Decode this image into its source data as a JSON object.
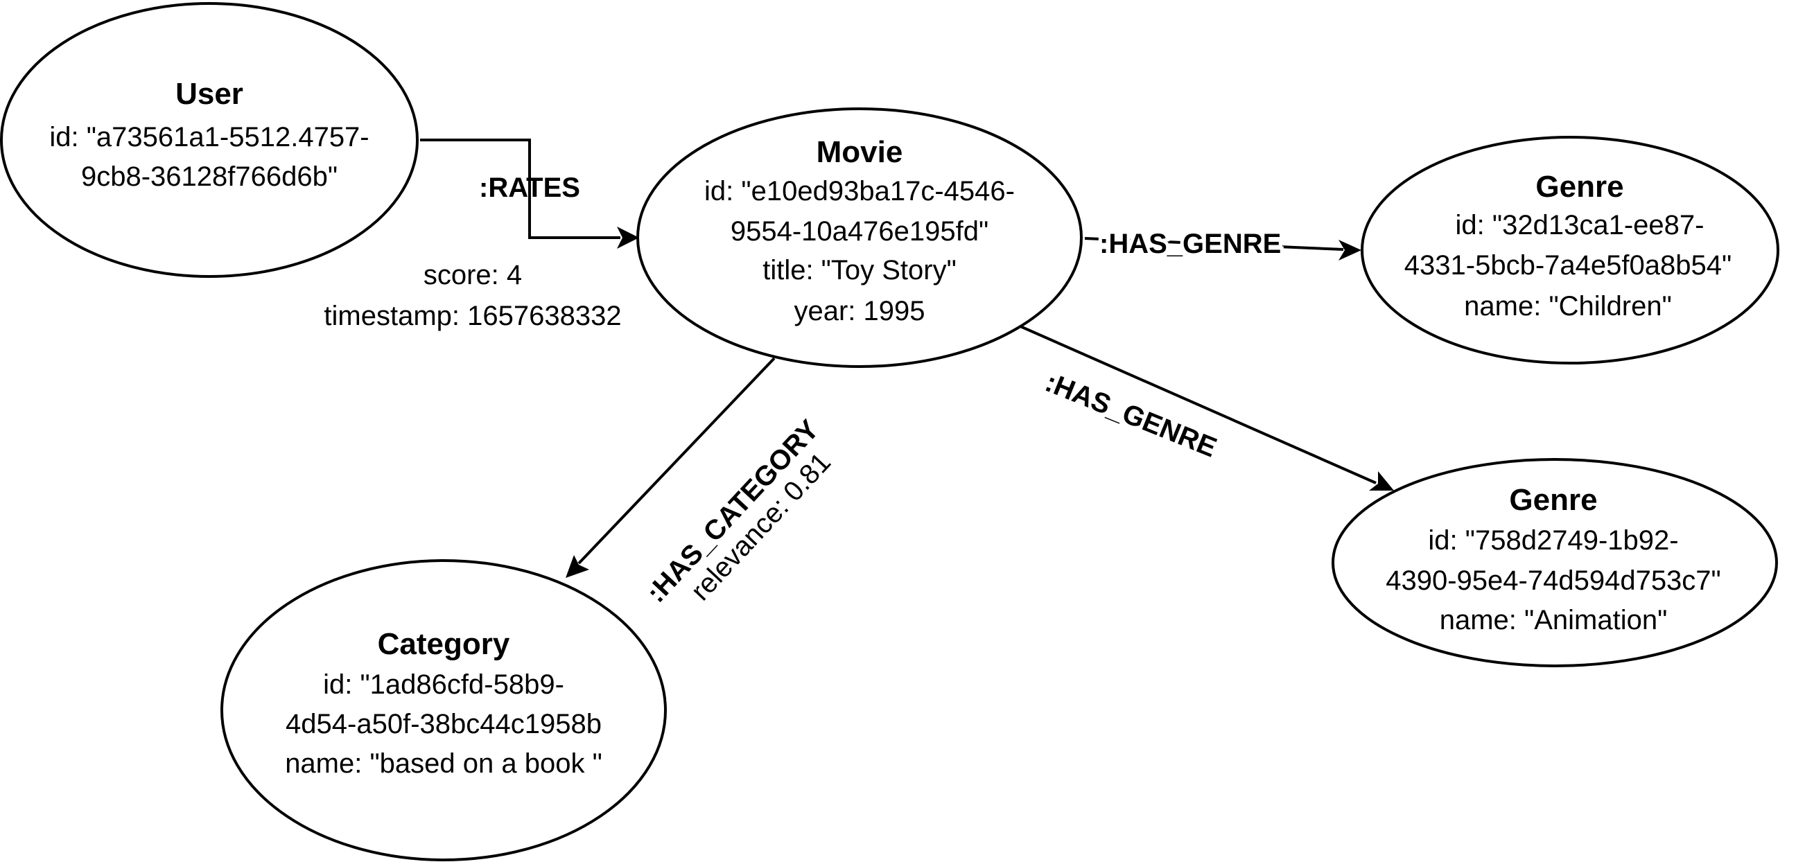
{
  "nodes": {
    "user": {
      "label": "User",
      "props": [
        "id: \"a73561a1-5512.4757-",
        "9cb8-36128f766d6b\""
      ]
    },
    "movie": {
      "label": "Movie",
      "props": [
        "id: \"e10ed93ba17c-4546-",
        "9554-10a476e195fd\"",
        "title: \"Toy Story\"",
        "year: 1995"
      ]
    },
    "genre_children": {
      "label": "Genre",
      "props": [
        "id: \"32d13ca1-ee87-",
        "4331-5bcb-7a4e5f0a8b54\"",
        "name: \"Children\""
      ]
    },
    "genre_animation": {
      "label": "Genre",
      "props": [
        "id: \"758d2749-1b92-",
        "4390-95e4-74d594d753c7\"",
        "name: \"Animation\""
      ]
    },
    "category": {
      "label": "Category",
      "props": [
        "id: \"1ad86cfd-58b9-",
        "4d54-a50f-38bc44c1958b",
        "name: \"based on a book \""
      ]
    }
  },
  "edges": {
    "rates": {
      "label": ":RATES",
      "props": [
        "score: 4",
        "timestamp: 1657638332"
      ]
    },
    "has_genre_children": {
      "label": ":HAS_GENRE"
    },
    "has_genre_animation": {
      "label": ":HAS_GENRE"
    },
    "has_category": {
      "label": ":HAS_CATEGORY",
      "props": [
        "relevance: 0.81"
      ]
    }
  },
  "colors": {
    "stroke": "#000000",
    "background": "#ffffff"
  }
}
